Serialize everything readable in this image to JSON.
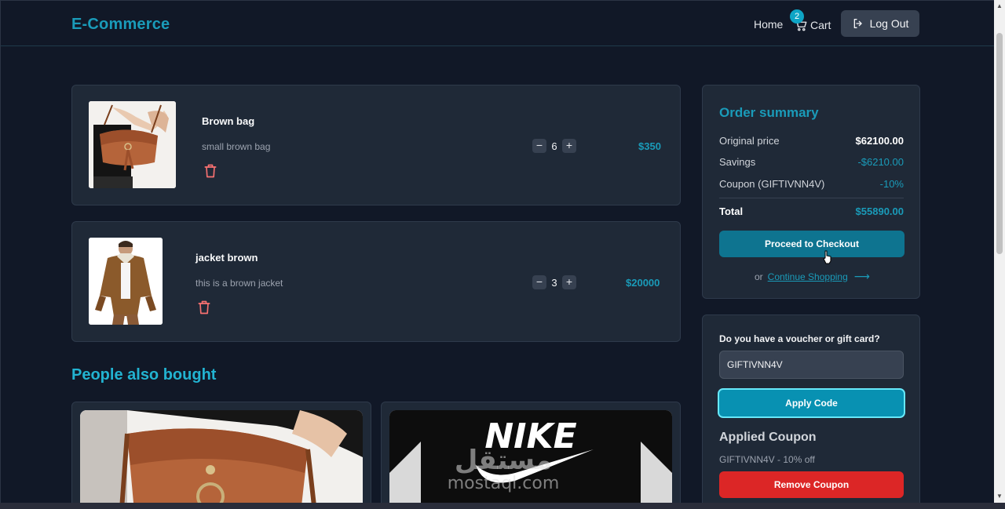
{
  "header": {
    "brand": "E-Commerce",
    "home_label": "Home",
    "cart_label": "Cart",
    "cart_count": "2",
    "logout_label": "Log Out"
  },
  "cart": {
    "items": [
      {
        "name": "Brown bag",
        "description": "small brown bag",
        "quantity": "6",
        "price": "$350"
      },
      {
        "name": "jacket brown",
        "description": "this is a brown jacket",
        "quantity": "3",
        "price": "$20000"
      }
    ]
  },
  "recommendations": {
    "title": "People also bought"
  },
  "summary": {
    "title": "Order summary",
    "original_price_label": "Original price",
    "original_price": "$62100.00",
    "savings_label": "Savings",
    "savings": "-$6210.00",
    "coupon_label": "Coupon (GIFTIVNN4V)",
    "coupon_value": "-10%",
    "total_label": "Total",
    "total": "$55890.00",
    "checkout_label": "Proceed to Checkout",
    "or_text": "or",
    "continue_label": "Continue Shopping",
    "continue_arrow": "⟶"
  },
  "voucher": {
    "question": "Do you have a voucher or gift card?",
    "input_value": "GIFTIVNN4V",
    "apply_label": "Apply Code",
    "applied_title": "Applied Coupon",
    "applied_text": "GIFTIVNN4V - 10% off",
    "remove_label": "Remove Coupon"
  },
  "watermark": {
    "arabic": "مستقل",
    "latin": "mostaql.com"
  },
  "colors": {
    "accent": "#1a9bb9",
    "background": "#111827",
    "card": "#1f2937",
    "danger": "#dc2626"
  },
  "icons": [
    "cart-icon",
    "logout-icon",
    "trash-icon",
    "minus-icon",
    "plus-icon",
    "arrow-right-icon"
  ]
}
